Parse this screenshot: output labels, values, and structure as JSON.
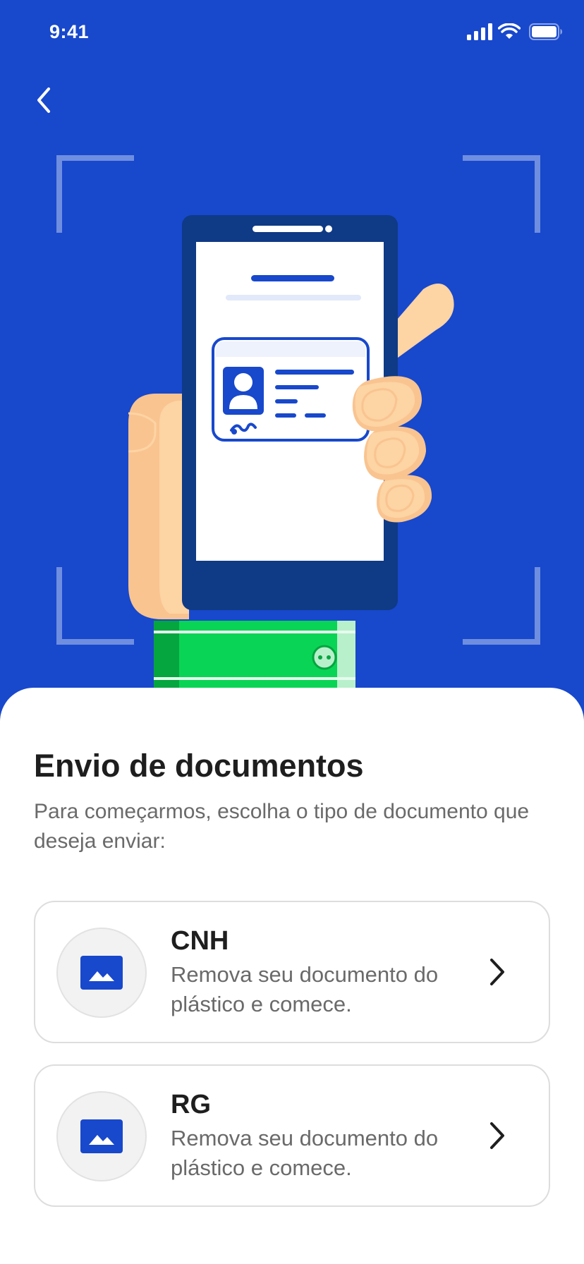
{
  "status_bar": {
    "time": "9:41",
    "icons": [
      "signal-icon",
      "wifi-icon",
      "battery-icon"
    ]
  },
  "nav": {
    "back_icon": "chevron-left-icon"
  },
  "colors": {
    "brand_blue": "#1848CC",
    "dark_blue": "#0F3A85",
    "sleeve_green": "#0AD455",
    "skin": "#FDD4A4"
  },
  "sheet": {
    "title": "Envio de documentos",
    "subtitle": "Para começarmos, escolha o tipo de documento que deseja enviar:"
  },
  "documents": [
    {
      "title": "CNH",
      "description": "Remova seu documento do plástico e comece.",
      "icon": "image-icon"
    },
    {
      "title": "RG",
      "description": "Remova seu documento do plástico e comece.",
      "icon": "image-icon"
    }
  ]
}
